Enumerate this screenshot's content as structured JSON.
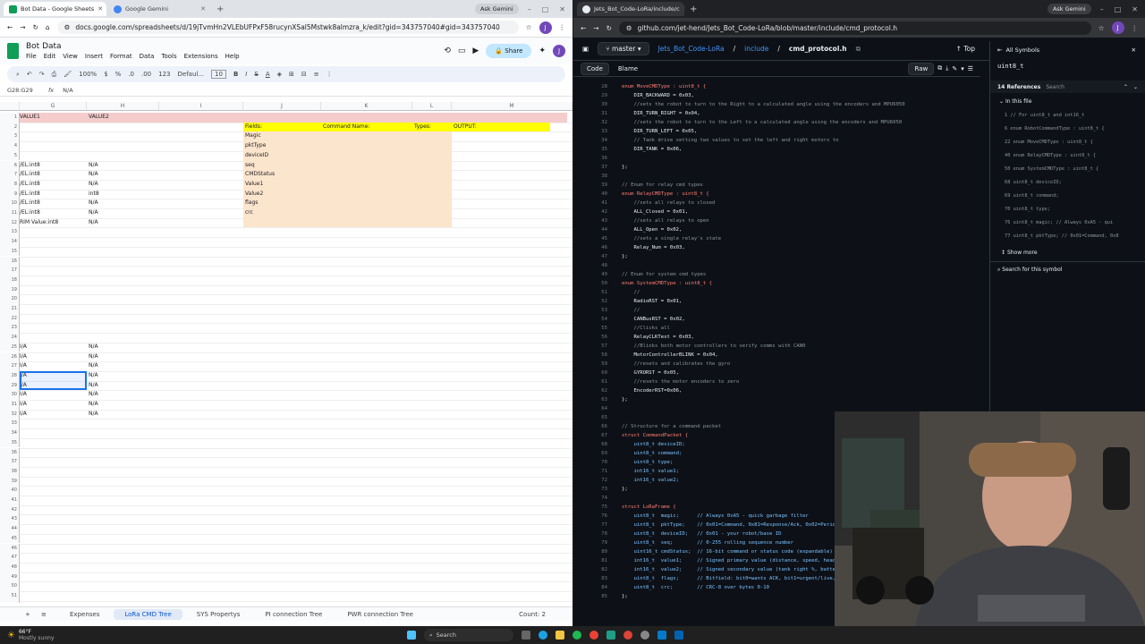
{
  "left": {
    "tabs": [
      {
        "label": "Bot Data - Google Sheets",
        "active": true,
        "color": "#0f9d58"
      },
      {
        "label": "Google Gemini",
        "active": false,
        "color": "#4285f4"
      }
    ],
    "ask": "Ask Gemini",
    "url": "docs.google.com/spreadsheets/d/19jTvmHn2VLEbUFPxF58rucynXSal5Mstwk8almzra_k/edit?gid=343757040#gid=343757040",
    "doc_title": "Bot Data",
    "menus": [
      "File",
      "Edit",
      "View",
      "Insert",
      "Format",
      "Data",
      "Tools",
      "Extensions",
      "Help"
    ],
    "share": "Share",
    "avatar": "J",
    "toolbar": [
      "100%",
      "$",
      "%",
      ".0",
      ".00",
      "123",
      "Defaul...",
      "10"
    ],
    "namebox": "G28:G29",
    "formula": "N/A",
    "columns": [
      "G",
      "H",
      "I",
      "J",
      "K",
      "L",
      "M"
    ],
    "rows": [
      "1",
      "2",
      "3",
      "4",
      "5",
      "6",
      "7",
      "8",
      "9",
      "10",
      "11",
      "12",
      "13",
      "14",
      "15",
      "16",
      "17",
      "18",
      "19",
      "20",
      "21",
      "22",
      "23",
      "24",
      "25",
      "26",
      "27",
      "28",
      "29",
      "30",
      "31",
      "32",
      "33",
      "34",
      "35",
      "36",
      "37",
      "38",
      "39",
      "40",
      "41",
      "42",
      "43",
      "44",
      "45",
      "46",
      "47",
      "48",
      "49",
      "50",
      "51",
      "52"
    ],
    "header_row": {
      "g": "VALUE1",
      "h": "VALUE2"
    },
    "fields_header": [
      "Fields:",
      "Command Name:",
      "Types:",
      "OUTPUT:"
    ],
    "fields": [
      "Magic",
      "pktType",
      "deviceID",
      "seq",
      "CMDStatus",
      "Value1",
      "Value2",
      "flags",
      "crc"
    ],
    "gcol": [
      {
        "r": 6,
        "v": "/EL:int8"
      },
      {
        "r": 7,
        "v": "/EL:int8"
      },
      {
        "r": 8,
        "v": "/EL:int8"
      },
      {
        "r": 9,
        "v": "/EL:int8"
      },
      {
        "r": 10,
        "v": "/EL:int8"
      },
      {
        "r": 11,
        "v": "/EL:int8"
      },
      {
        "r": 12,
        "v": "RIM Value:int8"
      },
      {
        "r": 25,
        "v": "I/A"
      },
      {
        "r": 26,
        "v": "I/A"
      },
      {
        "r": 27,
        "v": "I/A"
      },
      {
        "r": 28,
        "v": "I/A"
      },
      {
        "r": 29,
        "v": "I/A"
      },
      {
        "r": 30,
        "v": "I/A"
      },
      {
        "r": 31,
        "v": "I/A"
      },
      {
        "r": 32,
        "v": "I/A"
      }
    ],
    "hcol": [
      {
        "r": 6,
        "v": "N/A"
      },
      {
        "r": 7,
        "v": "N/A"
      },
      {
        "r": 8,
        "v": "N/A"
      },
      {
        "r": 9,
        "v": "int8"
      },
      {
        "r": 10,
        "v": "N/A"
      },
      {
        "r": 11,
        "v": "N/A"
      },
      {
        "r": 12,
        "v": "N/A"
      },
      {
        "r": 25,
        "v": "N/A"
      },
      {
        "r": 26,
        "v": "N/A"
      },
      {
        "r": 27,
        "v": "N/A"
      },
      {
        "r": 28,
        "v": "N/A"
      },
      {
        "r": 29,
        "v": "N/A"
      },
      {
        "r": 30,
        "v": "N/A"
      },
      {
        "r": 31,
        "v": "N/A"
      },
      {
        "r": 32,
        "v": "N/A"
      }
    ],
    "sheet_tabs": [
      "Expenses",
      "LoRa CMD Tree",
      "SYS Propertys",
      "PI connection Tree",
      "PWR connection Tree"
    ],
    "active_sheet": "LoRa CMD Tree",
    "count": "Count: 2"
  },
  "right": {
    "tabs": [
      {
        "label": "Jets_Bot_Code-LoRa/include/c",
        "active": true
      }
    ],
    "ask": "Ask Gemini",
    "url": "github.com/jet-hend/Jets_Bot_Code-LoRa/blob/master/include/cmd_protocol.h",
    "branch": "master",
    "crumbs": [
      "Jets_Bot_Code-LoRa",
      "include",
      "cmd_protocol.h"
    ],
    "top": "Top",
    "code_tabs": [
      "Code",
      "Blame"
    ],
    "raw": "Raw",
    "code_lines": [
      {
        "n": "28",
        "t": "enum MoveCMDType : uint8_t {",
        "k": "kw"
      },
      {
        "n": "29",
        "t": "    DIR_BACKWARD = 0x03,",
        "k": ""
      },
      {
        "n": "30",
        "t": "    //sets the robot to turn to the Right to a calculated angle using the encoders and MPU6050",
        "k": "cm"
      },
      {
        "n": "31",
        "t": "    DIR_TURN_RIGHT = 0x04,",
        "k": ""
      },
      {
        "n": "32",
        "t": "    //sets the robot to turn to the Left to a calculated angle using the encoders and MPU6050",
        "k": "cm"
      },
      {
        "n": "33",
        "t": "    DIR_TURN_LEFT = 0x05,",
        "k": ""
      },
      {
        "n": "34",
        "t": "    // Tank drive setting two values to set the left and right motors to",
        "k": "cm"
      },
      {
        "n": "35",
        "t": "    DIR_TANK = 0x06,",
        "k": ""
      },
      {
        "n": "36",
        "t": "",
        "k": ""
      },
      {
        "n": "37",
        "t": "};",
        "k": ""
      },
      {
        "n": "38",
        "t": "",
        "k": ""
      },
      {
        "n": "39",
        "t": "// Enum for relay cmd types",
        "k": "cm"
      },
      {
        "n": "40",
        "t": "enum RelayCMDType : uint8_t {",
        "k": "kw"
      },
      {
        "n": "41",
        "t": "    //sets all relays to closed",
        "k": "cm"
      },
      {
        "n": "42",
        "t": "    ALL_Closed = 0x01,",
        "k": ""
      },
      {
        "n": "43",
        "t": "    //sets all relays to open",
        "k": "cm"
      },
      {
        "n": "44",
        "t": "    ALL_Open = 0x02,",
        "k": ""
      },
      {
        "n": "45",
        "t": "    //sets a single relay's state",
        "k": "cm"
      },
      {
        "n": "46",
        "t": "    Relay_Num = 0x03,",
        "k": ""
      },
      {
        "n": "47",
        "t": "};",
        "k": ""
      },
      {
        "n": "48",
        "t": "",
        "k": ""
      },
      {
        "n": "49",
        "t": "// Enum for system cmd types",
        "k": "cm"
      },
      {
        "n": "50",
        "t": "enum SystemCMDType : uint8_t {",
        "k": "kw"
      },
      {
        "n": "51",
        "t": "    //",
        "k": "cm"
      },
      {
        "n": "52",
        "t": "    RadioRST = 0x01,",
        "k": ""
      },
      {
        "n": "53",
        "t": "    //",
        "k": "cm"
      },
      {
        "n": "54",
        "t": "    CANBusRST = 0x02,",
        "k": ""
      },
      {
        "n": "55",
        "t": "    //Clicks all",
        "k": "cm"
      },
      {
        "n": "56",
        "t": "    RelayCLKTest = 0x03,",
        "k": ""
      },
      {
        "n": "57",
        "t": "    //Blinks both motor controllers to verify comms with CAN0",
        "k": "cm"
      },
      {
        "n": "58",
        "t": "    MotorControllerBLINK = 0x04,",
        "k": ""
      },
      {
        "n": "59",
        "t": "    //resets and calibrates the gyro",
        "k": "cm"
      },
      {
        "n": "60",
        "t": "    GYRORST = 0x05,",
        "k": ""
      },
      {
        "n": "61",
        "t": "    //resets the motor encoders to zero",
        "k": "cm"
      },
      {
        "n": "62",
        "t": "    EncoderRST=0x06,",
        "k": ""
      },
      {
        "n": "63",
        "t": "};",
        "k": ""
      },
      {
        "n": "64",
        "t": "",
        "k": ""
      },
      {
        "n": "65",
        "t": "",
        "k": ""
      },
      {
        "n": "66",
        "t": "// Structure for a command packet",
        "k": "cm"
      },
      {
        "n": "67",
        "t": "struct CommandPacket {",
        "k": "kw"
      },
      {
        "n": "68",
        "t": "    uint8_t deviceID;",
        "k": "ty"
      },
      {
        "n": "69",
        "t": "    uint8_t command;",
        "k": "ty"
      },
      {
        "n": "70",
        "t": "    uint8_t type;",
        "k": "ty"
      },
      {
        "n": "71",
        "t": "    int16_t value1;",
        "k": "ty"
      },
      {
        "n": "72",
        "t": "    int16_t value2;",
        "k": "ty"
      },
      {
        "n": "73",
        "t": "};",
        "k": ""
      },
      {
        "n": "74",
        "t": "",
        "k": ""
      },
      {
        "n": "75",
        "t": "struct LoRaFrame {",
        "k": "kw"
      },
      {
        "n": "76",
        "t": "    uint8_t  magic;      // Always 0xA5 - quick garbage filter",
        "k": "ty"
      },
      {
        "n": "77",
        "t": "    uint8_t  pktType;    // 0x01=Command, 0x81=Response/Ack, 0x02=Perio",
        "k": "ty"
      },
      {
        "n": "78",
        "t": "    uint8_t  deviceID;   // 0x01 - your robot/base ID",
        "k": "ty"
      },
      {
        "n": "79",
        "t": "    uint8_t  seq;        // 0-255 rolling sequence number",
        "k": "ty"
      },
      {
        "n": "80",
        "t": "    uint16_t cmdStatus;  // 16-bit command or status code (expandable)",
        "k": "ty"
      },
      {
        "n": "81",
        "t": "    int16_t  value1;     // Signed primary value (distance, speed, head",
        "k": "ty"
      },
      {
        "n": "82",
        "t": "    int16_t  value2;     // Signed secondary value (tank right %, batte",
        "k": "ty"
      },
      {
        "n": "83",
        "t": "    uint8_t  flags;      // Bitfield: bit0=wants ACK, bit1=urgent/live,",
        "k": "ty"
      },
      {
        "n": "84",
        "t": "    uint8_t  crc;        // CRC-8 over bytes 0-10",
        "k": "ty"
      },
      {
        "n": "85",
        "t": "};",
        "k": ""
      }
    ],
    "symbols": {
      "title": "All Symbols",
      "symbol": "uint8_t",
      "refs": "14 References",
      "search": "Search",
      "in_file": "In this file",
      "items": [
        "1  // For uint8_t and int16_t",
        "6  enum RobotCommandType : uint8_t {",
        "22 enum MoveCMDType : uint8_t {",
        "40 enum RelayCMDType : uint8_t {",
        "50 enum SystemCMDType : uint8_t {",
        "68 uint8_t deviceID;",
        "69 uint8_t command;",
        "70 uint8_t type;",
        "76 uint8_t  magic;      // Always 0xA5 - qui",
        "77 uint8_t  pktType;    // 0x01=Command, 0x8"
      ],
      "show_more": "Show more",
      "search_symbol": "Search for this symbol"
    }
  },
  "taskbar": {
    "temp": "66°F",
    "weather": "Mostly sunny",
    "search": "Search"
  }
}
